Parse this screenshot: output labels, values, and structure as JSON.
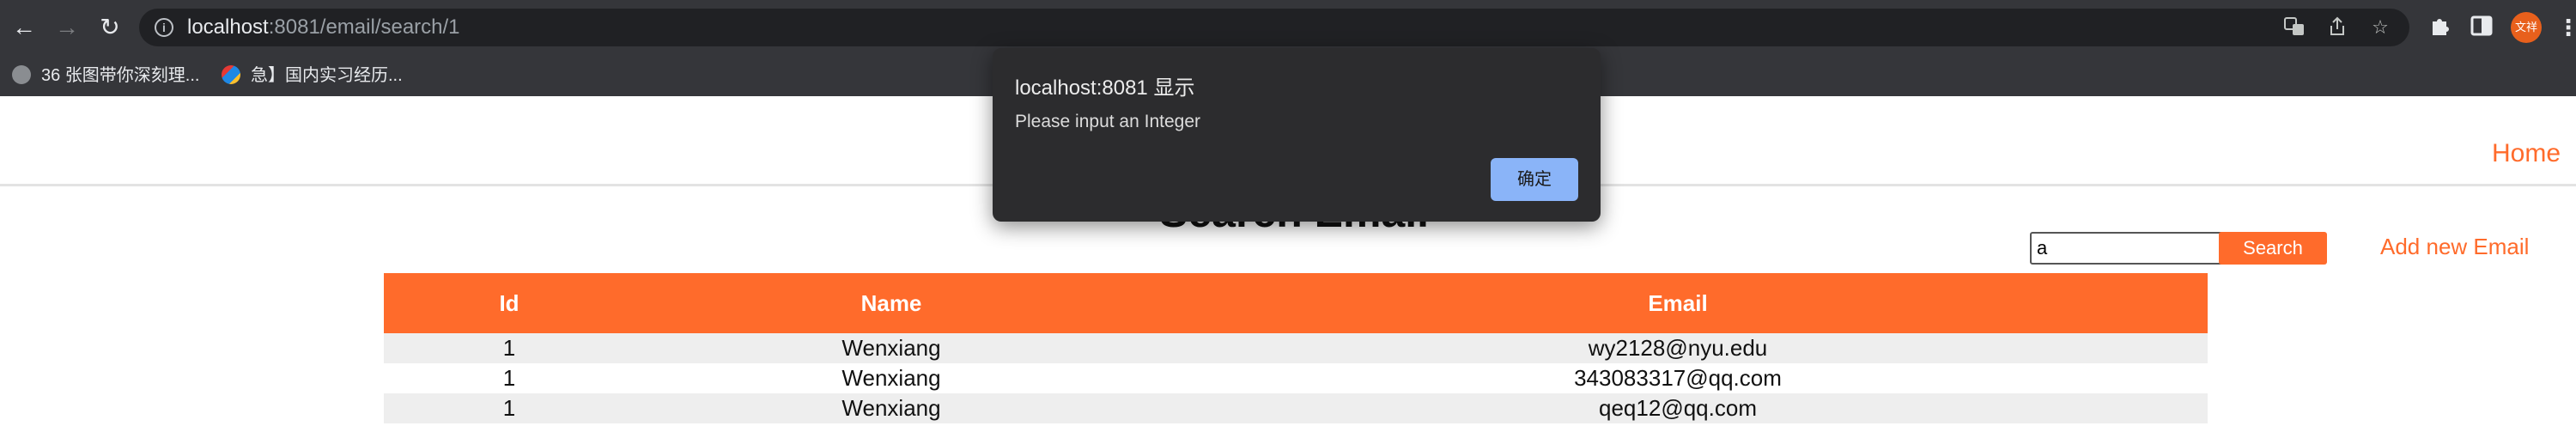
{
  "browser": {
    "url_host": "localhost",
    "url_rest": ":8081/email/search/1",
    "nav": {
      "back": "←",
      "forward": "→",
      "reload": "↻"
    },
    "omnibox_icons": [
      "translate-icon",
      "share-icon",
      "bookmark-star-icon"
    ],
    "extensions": [
      "puzzle-icon",
      "sidepanel-icon"
    ],
    "profile_label": "文祥",
    "bookmarks": [
      {
        "label": "36 张图带你深刻理...",
        "icon": "globe-icon"
      },
      {
        "label": "急】国内实习经历...",
        "icon": "tool-icon"
      }
    ]
  },
  "header": {
    "home_label": "Home"
  },
  "main": {
    "title": "Search Email",
    "search": {
      "value": "a",
      "button_label": "Search"
    },
    "add_label": "Add new Email",
    "table": {
      "columns": [
        "Id",
        "Name",
        "Email"
      ],
      "rows": [
        {
          "id": "1",
          "name": "Wenxiang",
          "email": "wy2128@nyu.edu"
        },
        {
          "id": "1",
          "name": "Wenxiang",
          "email": "343083317@qq.com"
        },
        {
          "id": "1",
          "name": "Wenxiang",
          "email": "qeq12@qq.com"
        }
      ]
    }
  },
  "alert": {
    "title": "localhost:8081 显示",
    "message": "Please input an Integer",
    "ok_label": "确定"
  },
  "colors": {
    "accent": "#ff6b2b",
    "chrome_bg": "#35363a",
    "dialog_bg": "#2c2c2e",
    "dialog_button": "#8ab4f8"
  }
}
